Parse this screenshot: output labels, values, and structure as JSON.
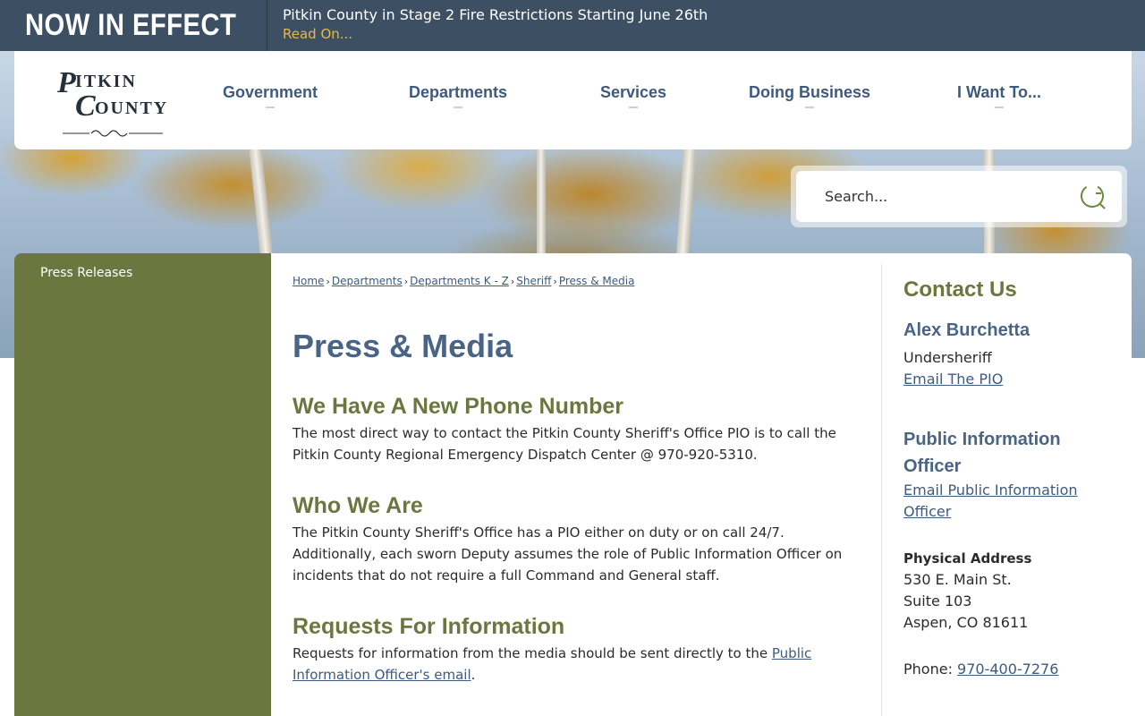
{
  "alert": {
    "label": "NOW IN EFFECT",
    "message": "Pitkin County in Stage 2 Fire Restrictions Starting June 26th",
    "link": "Read On..."
  },
  "logo": {
    "line1": "Pitkin",
    "line2": "County"
  },
  "nav": {
    "items": [
      "Government",
      "Departments",
      "Services",
      "Doing Business",
      "I Want To..."
    ]
  },
  "search": {
    "placeholder": "Search..."
  },
  "sidebar": {
    "items": [
      "Press Releases"
    ]
  },
  "breadcrumb": [
    "Home",
    "Departments",
    "Departments K - Z",
    "Sheriff",
    "Press & Media"
  ],
  "page": {
    "title": "Press & Media",
    "sections": [
      {
        "heading": "We Have A New Phone Number",
        "body": "The most direct way to contact the Pitkin County Sheriff's Office PIO is to call the Pitkin County Regional Emergency Dispatch Center @ 970-920-5310."
      },
      {
        "heading": "Who We Are",
        "body": "The Pitkin County Sheriff's Office has a PIO either on duty or on call 24/7. Additionally, each sworn Deputy assumes the role of Public Information Officer on incidents that do not require a full Command and General staff."
      },
      {
        "heading": "Requests For Information",
        "body_prefix": "Requests for information from the media should be sent directly to the ",
        "link": "Public Information Officer's email",
        "body_suffix": "."
      }
    ]
  },
  "contact": {
    "title": "Contact Us",
    "person_name": "Alex Burchetta",
    "person_role": "Undersheriff",
    "person_link": "Email The PIO",
    "officer_title": "Public Information Officer",
    "officer_link": "Email Public Information Officer",
    "address_label": "Physical Address",
    "address": [
      "530 E. Main St.",
      "Suite 103",
      "Aspen, CO 81611"
    ],
    "phone_label": "Phone: ",
    "phone": "970-400-7276"
  },
  "colors": {
    "alert_bar": "#3d4f63",
    "alert_link": "#e6b84a",
    "nav_text": "#3e5a7e",
    "sidebar": "#6b773e",
    "heading_green": "#6b773e",
    "title_blue": "#4a6486"
  }
}
